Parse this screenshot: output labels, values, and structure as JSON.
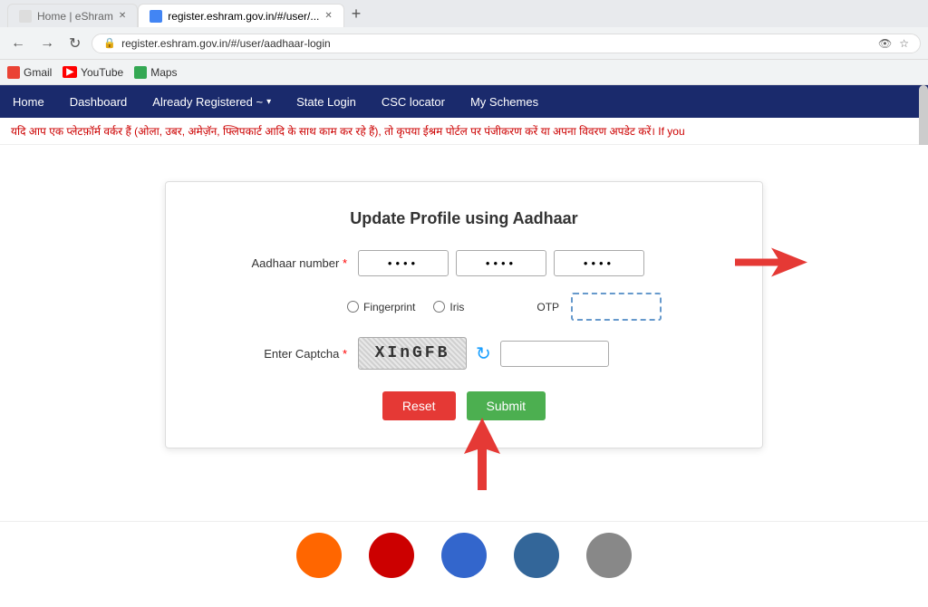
{
  "browser": {
    "tabs": [
      {
        "label": "Home | eShram",
        "active": false
      },
      {
        "label": "register.eshram.gov.in/#/user/...",
        "active": true
      }
    ],
    "address": "register.eshram.gov.in/#/user/aadhaar-login",
    "bookmarks": [
      {
        "label": "Gmail",
        "icon": "gmail"
      },
      {
        "label": "YouTube",
        "icon": "youtube"
      },
      {
        "label": "Maps",
        "icon": "maps"
      }
    ]
  },
  "nav": {
    "items": [
      {
        "label": "Home",
        "dropdown": false
      },
      {
        "label": "Dashboard",
        "dropdown": false
      },
      {
        "label": "Already Registered ~",
        "dropdown": true
      },
      {
        "label": "State Login",
        "dropdown": false
      },
      {
        "label": "CSC locator",
        "dropdown": false
      },
      {
        "label": "My Schemes",
        "dropdown": false
      }
    ]
  },
  "marquee": {
    "text": "यदि आप एक प्लेटफ़ॉर्म वर्कर हैं (ओला, उबर, अमेज़ॅन, फ्लिपकार्ट आदि के साथ काम कर रहे हैं), तो कृपया ईश्रम पोर्टल पर पंजीकरण करें या अपना विवरण अपडेट करें। If you"
  },
  "form": {
    "title": "Update Profile using Aadhaar",
    "aadhaar_label": "Aadhaar number",
    "aadhaar_required": "*",
    "aadhaar_segments": [
      "....",
      "....",
      "...."
    ],
    "auth_options": [
      {
        "label": "Fingerprint",
        "value": "fingerprint"
      },
      {
        "label": "Iris",
        "value": "iris"
      },
      {
        "label": "OTP",
        "value": "otp"
      }
    ],
    "otp_placeholder": "OTP",
    "captcha_label": "Enter Captcha",
    "captcha_required": "*",
    "captcha_text": "XInGFB",
    "captcha_input_placeholder": "",
    "reset_label": "Reset",
    "submit_label": "Submit"
  },
  "logos": [
    {
      "color": "#ff6600",
      "label": ""
    },
    {
      "color": "#cc0000",
      "label": ""
    },
    {
      "color": "#3366cc",
      "label": ""
    },
    {
      "color": "#336699",
      "label": ""
    },
    {
      "color": "#888888",
      "label": ""
    }
  ]
}
